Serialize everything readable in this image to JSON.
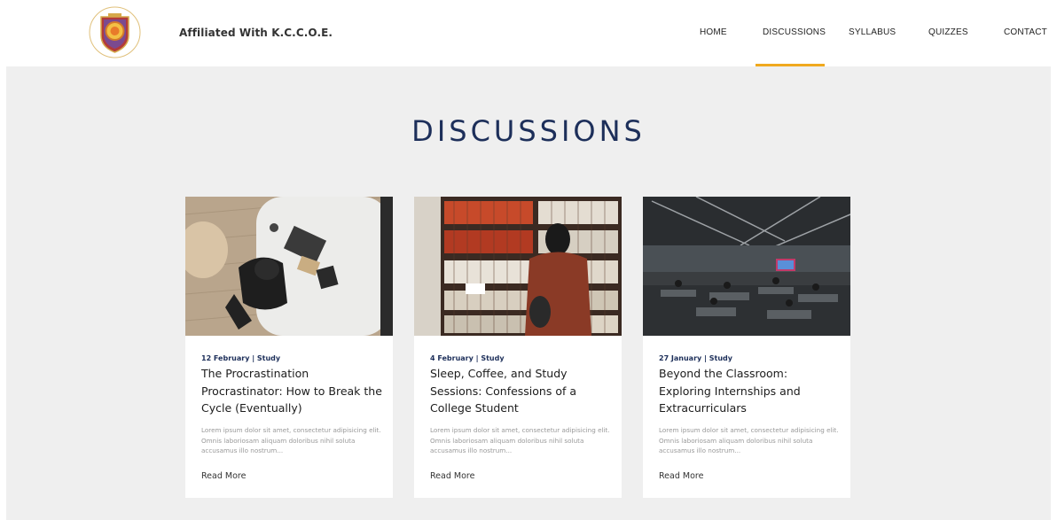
{
  "header": {
    "brand": "Affiliated With K.C.C.O.E.",
    "nav": [
      {
        "label": "HOME"
      },
      {
        "label": "DISCUSSIONS"
      },
      {
        "label": "SYLLABUS"
      },
      {
        "label": "QUIZZES"
      },
      {
        "label": "CONTACT"
      }
    ],
    "active_color": "#f0a91e"
  },
  "main": {
    "title": "DISCUSSIONS",
    "title_color": "#1d2f5a",
    "cards": [
      {
        "image": "student-laptop-photo",
        "meta": "12 February | Study",
        "title": "The Procrastination Procrastinator: How to Break the Cycle (Eventually)",
        "excerpt": "Lorem ipsum dolor sit amet, consectetur adipisicing elit. Omnis laboriosam aliquam doloribus nihil soluta accusamus illo nostrum...",
        "link": "Read More"
      },
      {
        "image": "library-bookshelf-photo",
        "meta": "4 February | Study",
        "title": "Sleep, Coffee, and Study Sessions: Confessions of a College Student",
        "excerpt": "Lorem ipsum dolor sit amet, consectetur adipisicing elit. Omnis laboriosam aliquam doloribus nihil soluta accusamus illo nostrum...",
        "link": "Read More"
      },
      {
        "image": "event-hall-photo",
        "meta": "27 January | Study",
        "title": "Beyond the Classroom: Exploring Internships and Extracurriculars",
        "excerpt": "Lorem ipsum dolor sit amet, consectetur adipisicing elit. Omnis laboriosam aliquam doloribus nihil soluta accusamus illo nostrum...",
        "link": "Read More"
      }
    ]
  }
}
